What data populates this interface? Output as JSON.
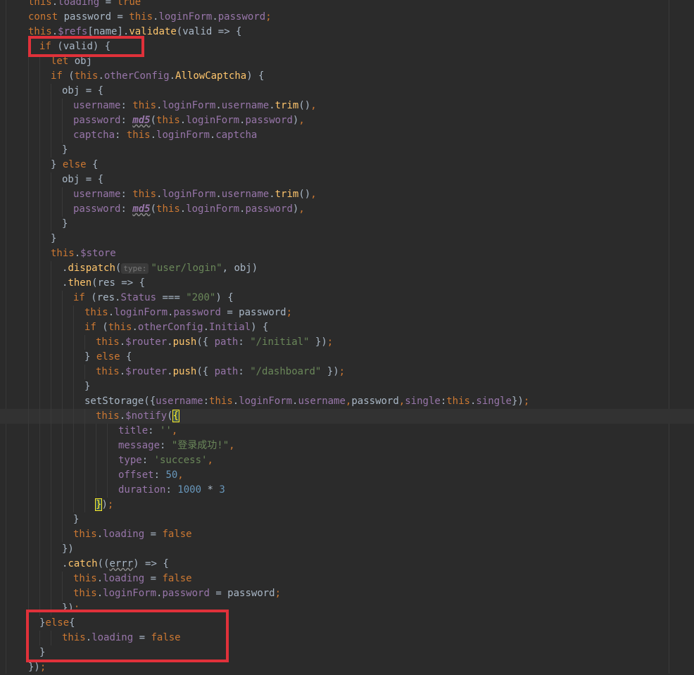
{
  "colors": {
    "background": "#2b2b2b",
    "keyword": "#cc7832",
    "property": "#9876aa",
    "function": "#ffc66d",
    "string": "#6a8759",
    "number": "#6897bb",
    "highlight_box": "#e0313a"
  },
  "editor": {
    "lines": [
      {
        "indent": 0,
        "tokens": [
          [
            "this",
            "this"
          ],
          [
            ".",
            ""
          ],
          [
            "loading",
            "prop"
          ],
          [
            " = ",
            ""
          ],
          [
            "true",
            "kw"
          ]
        ]
      },
      {
        "indent": 0,
        "tokens": [
          [
            "const ",
            "kw"
          ],
          [
            "password = ",
            ""
          ],
          [
            "this",
            "this"
          ],
          [
            ".",
            ""
          ],
          [
            "loginForm",
            "prop"
          ],
          [
            ".",
            ""
          ],
          [
            "password",
            "prop"
          ],
          [
            ";",
            "kw"
          ]
        ]
      },
      {
        "indent": 0,
        "tokens": [
          [
            "this",
            "this"
          ],
          [
            ".",
            ""
          ],
          [
            "$refs",
            "prop"
          ],
          [
            "[name].",
            ""
          ],
          [
            "validate",
            "fn"
          ],
          [
            "(valid => {",
            ""
          ]
        ]
      },
      {
        "indent": 1,
        "tokens": [
          [
            "if ",
            "kw"
          ],
          [
            "(valid) {",
            ""
          ]
        ]
      },
      {
        "indent": 2,
        "tokens": [
          [
            "let ",
            "kw"
          ],
          [
            "obj",
            ""
          ]
        ]
      },
      {
        "indent": 2,
        "tokens": [
          [
            "if ",
            "kw"
          ],
          [
            "(",
            ""
          ],
          [
            "this",
            "this"
          ],
          [
            ".",
            ""
          ],
          [
            "otherConfig",
            "prop"
          ],
          [
            ".",
            ""
          ],
          [
            "AllowCaptcha",
            "fn"
          ],
          [
            ") {",
            ""
          ]
        ]
      },
      {
        "indent": 3,
        "tokens": [
          [
            "obj = {",
            ""
          ]
        ]
      },
      {
        "indent": 4,
        "tokens": [
          [
            "username",
            "prop"
          ],
          [
            ": ",
            ""
          ],
          [
            "this",
            "this"
          ],
          [
            ".",
            ""
          ],
          [
            "loginForm",
            "prop"
          ],
          [
            ".",
            ""
          ],
          [
            "username",
            "prop"
          ],
          [
            ".",
            ""
          ],
          [
            "trim",
            "fn"
          ],
          [
            "()",
            ""
          ],
          [
            ",",
            "kw"
          ]
        ]
      },
      {
        "indent": 4,
        "tokens": [
          [
            "password",
            "prop"
          ],
          [
            ": ",
            ""
          ],
          [
            "md5",
            "it"
          ],
          [
            "(",
            ""
          ],
          [
            "this",
            "this"
          ],
          [
            ".",
            ""
          ],
          [
            "loginForm",
            "prop"
          ],
          [
            ".",
            ""
          ],
          [
            "password",
            "prop"
          ],
          [
            ")",
            ""
          ],
          [
            ",",
            "kw"
          ]
        ]
      },
      {
        "indent": 4,
        "tokens": [
          [
            "captcha",
            "prop"
          ],
          [
            ": ",
            ""
          ],
          [
            "this",
            "this"
          ],
          [
            ".",
            ""
          ],
          [
            "loginForm",
            "prop"
          ],
          [
            ".",
            ""
          ],
          [
            "captcha",
            "prop"
          ]
        ]
      },
      {
        "indent": 3,
        "tokens": [
          [
            "}",
            ""
          ]
        ]
      },
      {
        "indent": 2,
        "tokens": [
          [
            "} ",
            ""
          ],
          [
            "else ",
            "kw"
          ],
          [
            "{",
            ""
          ]
        ]
      },
      {
        "indent": 3,
        "tokens": [
          [
            "obj = {",
            ""
          ]
        ]
      },
      {
        "indent": 4,
        "tokens": [
          [
            "username",
            "prop"
          ],
          [
            ": ",
            ""
          ],
          [
            "this",
            "this"
          ],
          [
            ".",
            ""
          ],
          [
            "loginForm",
            "prop"
          ],
          [
            ".",
            ""
          ],
          [
            "username",
            "prop"
          ],
          [
            ".",
            ""
          ],
          [
            "trim",
            "fn"
          ],
          [
            "()",
            ""
          ],
          [
            ",",
            "kw"
          ]
        ]
      },
      {
        "indent": 4,
        "tokens": [
          [
            "password",
            "prop"
          ],
          [
            ": ",
            ""
          ],
          [
            "md5",
            "it"
          ],
          [
            "(",
            ""
          ],
          [
            "this",
            "this"
          ],
          [
            ".",
            ""
          ],
          [
            "loginForm",
            "prop"
          ],
          [
            ".",
            ""
          ],
          [
            "password",
            "prop"
          ],
          [
            ")",
            ""
          ],
          [
            ",",
            "kw"
          ]
        ]
      },
      {
        "indent": 3,
        "tokens": [
          [
            "}",
            ""
          ]
        ]
      },
      {
        "indent": 2,
        "tokens": [
          [
            "}",
            ""
          ]
        ]
      },
      {
        "indent": 2,
        "tokens": [
          [
            "this",
            "this"
          ],
          [
            ".",
            ""
          ],
          [
            "$store",
            "prop"
          ]
        ]
      },
      {
        "indent": 3,
        "tokens": [
          [
            ".",
            ""
          ],
          [
            "dispatch",
            "fn"
          ],
          [
            "(",
            ""
          ],
          [
            "type:",
            "hint"
          ],
          [
            "\"user/login\"",
            "str"
          ],
          [
            ", obj)",
            ""
          ]
        ]
      },
      {
        "indent": 3,
        "tokens": [
          [
            ".",
            ""
          ],
          [
            "then",
            "fn"
          ],
          [
            "(res => {",
            ""
          ]
        ]
      },
      {
        "indent": 4,
        "tokens": [
          [
            "if ",
            "kw"
          ],
          [
            "(res.",
            ""
          ],
          [
            "Status",
            "prop"
          ],
          [
            " === ",
            ""
          ],
          [
            "\"200\"",
            "str"
          ],
          [
            ") {",
            ""
          ]
        ]
      },
      {
        "indent": 5,
        "tokens": [
          [
            "this",
            "this"
          ],
          [
            ".",
            ""
          ],
          [
            "loginForm",
            "prop"
          ],
          [
            ".",
            ""
          ],
          [
            "password",
            "prop"
          ],
          [
            " = password",
            ""
          ],
          [
            ";",
            "kw"
          ]
        ]
      },
      {
        "indent": 5,
        "tokens": [
          [
            "if ",
            "kw"
          ],
          [
            "(",
            ""
          ],
          [
            "this",
            "this"
          ],
          [
            ".",
            ""
          ],
          [
            "otherConfig",
            "prop"
          ],
          [
            ".",
            ""
          ],
          [
            "Initial",
            "prop"
          ],
          [
            ") {",
            ""
          ]
        ]
      },
      {
        "indent": 6,
        "tokens": [
          [
            "this",
            "this"
          ],
          [
            ".",
            ""
          ],
          [
            "$router",
            "prop"
          ],
          [
            ".",
            ""
          ],
          [
            "push",
            "fn"
          ],
          [
            "({ ",
            ""
          ],
          [
            "path",
            "prop"
          ],
          [
            ": ",
            ""
          ],
          [
            "\"/initial\"",
            "str"
          ],
          [
            " })",
            ""
          ],
          [
            ";",
            "kw"
          ]
        ]
      },
      {
        "indent": 5,
        "tokens": [
          [
            "} ",
            ""
          ],
          [
            "else ",
            "kw"
          ],
          [
            "{",
            ""
          ]
        ]
      },
      {
        "indent": 6,
        "tokens": [
          [
            "this",
            "this"
          ],
          [
            ".",
            ""
          ],
          [
            "$router",
            "prop"
          ],
          [
            ".",
            ""
          ],
          [
            "push",
            "fn"
          ],
          [
            "({ ",
            ""
          ],
          [
            "path",
            "prop"
          ],
          [
            ": ",
            ""
          ],
          [
            "\"/dashboard\"",
            "str"
          ],
          [
            " })",
            ""
          ],
          [
            ";",
            "kw"
          ]
        ]
      },
      {
        "indent": 5,
        "tokens": [
          [
            "}",
            ""
          ]
        ]
      },
      {
        "indent": 5,
        "tokens": [
          [
            "setStorage",
            ""
          ],
          [
            "({",
            ""
          ],
          [
            "username",
            "prop"
          ],
          [
            ":",
            ""
          ],
          [
            "this",
            "this"
          ],
          [
            ".",
            ""
          ],
          [
            "loginForm",
            "prop"
          ],
          [
            ".",
            ""
          ],
          [
            "username",
            "prop"
          ],
          [
            ",",
            "kw"
          ],
          [
            "password",
            ""
          ],
          [
            ",",
            "kw"
          ],
          [
            "single",
            "prop"
          ],
          [
            ":",
            ""
          ],
          [
            "this",
            "this"
          ],
          [
            ".",
            ""
          ],
          [
            "single",
            "prop"
          ],
          [
            "})",
            ""
          ],
          [
            ";",
            "kw"
          ]
        ]
      },
      {
        "indent": 6,
        "tokens": [
          [
            "this",
            "this"
          ],
          [
            ".",
            ""
          ],
          [
            "$notify",
            "prop"
          ],
          [
            "(",
            ""
          ],
          [
            "{",
            "brace"
          ]
        ]
      },
      {
        "indent": 8,
        "tokens": [
          [
            "title",
            "prop"
          ],
          [
            ": ",
            ""
          ],
          [
            "''",
            "str"
          ],
          [
            ",",
            "kw"
          ]
        ]
      },
      {
        "indent": 8,
        "tokens": [
          [
            "message",
            "prop"
          ],
          [
            ": ",
            ""
          ],
          [
            "\"登录成功!\"",
            "str"
          ],
          [
            ",",
            "kw"
          ]
        ]
      },
      {
        "indent": 8,
        "tokens": [
          [
            "type",
            "prop"
          ],
          [
            ": ",
            ""
          ],
          [
            "'success'",
            "str"
          ],
          [
            ",",
            "kw"
          ]
        ]
      },
      {
        "indent": 8,
        "tokens": [
          [
            "offset",
            "prop"
          ],
          [
            ": ",
            ""
          ],
          [
            "50",
            "num"
          ],
          [
            ",",
            "kw"
          ]
        ]
      },
      {
        "indent": 8,
        "tokens": [
          [
            "duration",
            "prop"
          ],
          [
            ": ",
            ""
          ],
          [
            "1000",
            "num"
          ],
          [
            " * ",
            ""
          ],
          [
            "3",
            "num"
          ]
        ]
      },
      {
        "indent": 6,
        "tokens": [
          [
            "}",
            "brace"
          ],
          [
            ")",
            ""
          ],
          [
            ";",
            "kw"
          ]
        ]
      },
      {
        "indent": 4,
        "tokens": [
          [
            "}",
            ""
          ]
        ]
      },
      {
        "indent": 4,
        "tokens": [
          [
            "this",
            "this"
          ],
          [
            ".",
            ""
          ],
          [
            "loading",
            "prop"
          ],
          [
            " = ",
            ""
          ],
          [
            "false",
            "kw"
          ]
        ]
      },
      {
        "indent": 3,
        "tokens": [
          [
            "})",
            ""
          ]
        ]
      },
      {
        "indent": 3,
        "tokens": [
          [
            ".",
            ""
          ],
          [
            "catch",
            "fn"
          ],
          [
            "((",
            ""
          ],
          [
            "errr",
            "ul"
          ],
          [
            ") => {",
            ""
          ]
        ]
      },
      {
        "indent": 4,
        "tokens": [
          [
            "this",
            "this"
          ],
          [
            ".",
            ""
          ],
          [
            "loading",
            "prop"
          ],
          [
            " = ",
            ""
          ],
          [
            "false",
            "kw"
          ]
        ]
      },
      {
        "indent": 4,
        "tokens": [
          [
            "this",
            "this"
          ],
          [
            ".",
            ""
          ],
          [
            "loginForm",
            "prop"
          ],
          [
            ".",
            ""
          ],
          [
            "password",
            "prop"
          ],
          [
            " = password",
            ""
          ],
          [
            ";",
            "kw"
          ]
        ]
      },
      {
        "indent": 3,
        "tokens": [
          [
            "})",
            ""
          ],
          [
            ";",
            "kw"
          ]
        ]
      },
      {
        "indent": 1,
        "tokens": [
          [
            "}",
            ""
          ],
          [
            "else",
            "kw"
          ],
          [
            "{",
            ""
          ]
        ]
      },
      {
        "indent": 3,
        "tokens": [
          [
            "this",
            "this"
          ],
          [
            ".",
            ""
          ],
          [
            "loading",
            "prop"
          ],
          [
            " = ",
            ""
          ],
          [
            "false",
            "kw"
          ]
        ]
      },
      {
        "indent": 1,
        "tokens": [
          [
            "}",
            ""
          ]
        ]
      },
      {
        "indent": 0,
        "tokens": [
          [
            "})",
            ""
          ],
          [
            ";",
            "kw"
          ]
        ]
      }
    ]
  }
}
